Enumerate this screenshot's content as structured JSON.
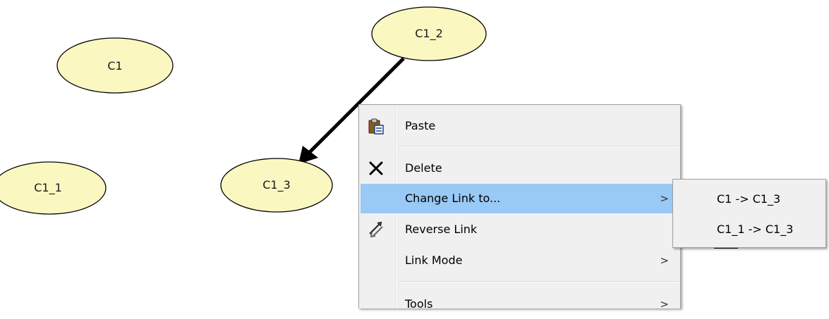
{
  "graph": {
    "nodes": [
      {
        "id": "C1",
        "label": "C1"
      },
      {
        "id": "C1_2",
        "label": "C1_2"
      },
      {
        "id": "C1_1",
        "label": "C1_1"
      },
      {
        "id": "C1_3",
        "label": "C1_3"
      }
    ],
    "links": [
      {
        "from": "C1_2",
        "to": "C1_3"
      }
    ],
    "node_fill": "#fbf7c1",
    "node_stroke": "#000000"
  },
  "context_menu": {
    "items": [
      {
        "label": "Paste",
        "icon": "paste-icon"
      },
      {
        "label": "Delete",
        "icon": "delete-icon"
      },
      {
        "label": "Change Link to...",
        "submenu": true,
        "highlighted": true
      },
      {
        "label": "Reverse Link",
        "icon": "reverse-link-icon"
      },
      {
        "label": "Link Mode",
        "submenu": true
      },
      {
        "label": "Tools",
        "submenu": true
      }
    ],
    "submenu_arrow": ">",
    "highlight_color": "#99c9f5"
  },
  "submenu": {
    "items": [
      {
        "label": "C1 -> C1_3"
      },
      {
        "label": "C1_1 -> C1_3"
      }
    ]
  }
}
